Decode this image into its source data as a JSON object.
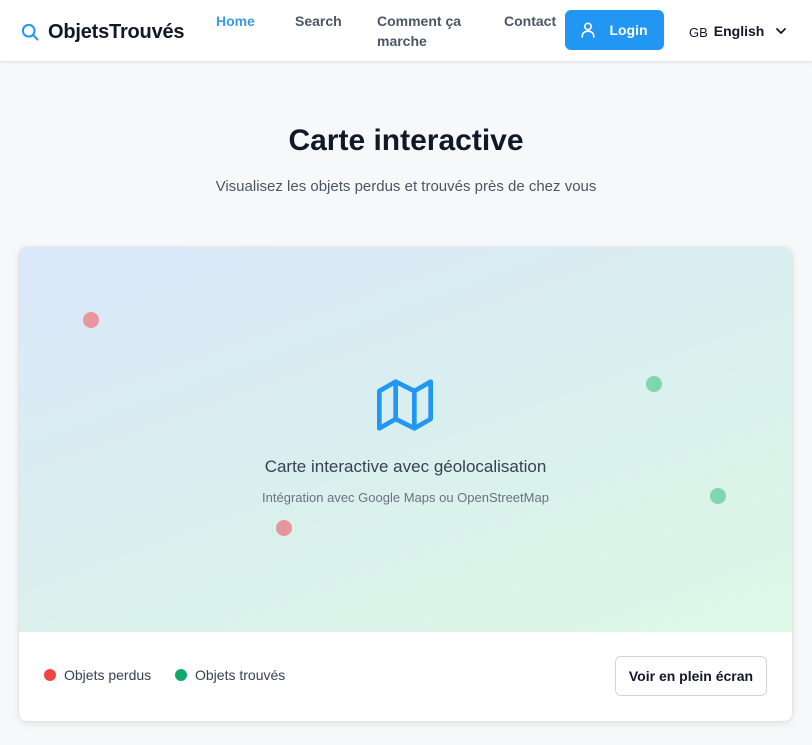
{
  "header": {
    "brand": "ObjetsTrouvés",
    "nav": [
      {
        "label": "Home",
        "active": true
      },
      {
        "label": "Search",
        "active": false
      },
      {
        "label": "Comment ça",
        "label2": "marche",
        "active": false
      },
      {
        "label": "Contact",
        "active": false
      }
    ],
    "login_label": "Login",
    "language": {
      "flag": "GB",
      "label": "English"
    }
  },
  "hero": {
    "title": "Carte interactive",
    "subtitle": "Visualisez les objets perdus et trouvés près de chez vous"
  },
  "map": {
    "title": "Carte interactive avec géolocalisation",
    "subtitle": "Intégration avec Google Maps ou OpenStreetMap"
  },
  "legend": {
    "lost_label": "Objets perdus",
    "found_label": "Objets trouvés",
    "lost_color": "#ef4444",
    "found_color": "#10a86b"
  },
  "fullscreen_label": "Voir en plein écran",
  "colors": {
    "accent": "#2196f3",
    "nav_active": "#3b9ae8"
  }
}
